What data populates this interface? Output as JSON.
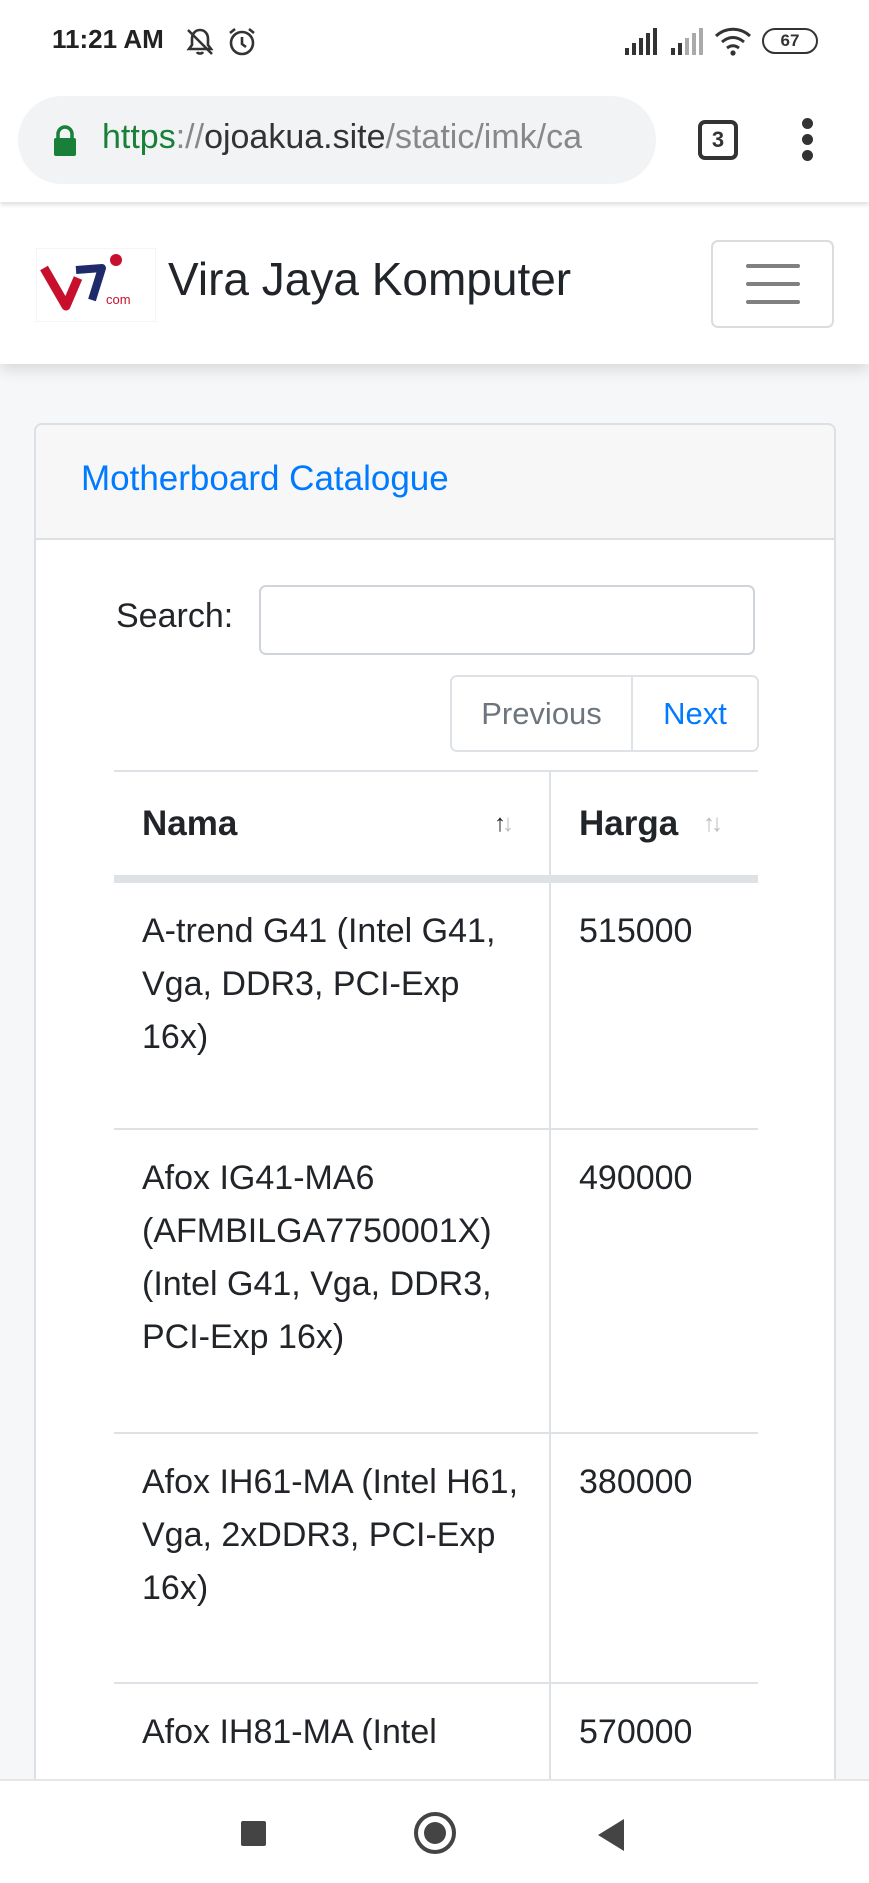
{
  "status_bar": {
    "time": "11:21 AM",
    "battery": "67",
    "icons": [
      "mute-icon",
      "alarm-icon",
      "signal-icon",
      "signal-weak-icon",
      "wifi-icon",
      "battery-icon"
    ]
  },
  "browser": {
    "url_scheme": "https",
    "url_sep": "://",
    "url_host": "ojoakua.site",
    "url_path": "/static/imk/ca",
    "tab_count": "3"
  },
  "navbar": {
    "brand_name": "Vira Jaya Komputer",
    "logo_text": "com"
  },
  "card": {
    "title": "Motherboard Catalogue",
    "search_label": "Search:",
    "search_value": "",
    "pagination": {
      "previous": "Previous",
      "next": "Next"
    }
  },
  "table": {
    "columns": [
      {
        "label": "Nama",
        "sort": "asc"
      },
      {
        "label": "Harga",
        "sort": "none"
      }
    ],
    "rows": [
      {
        "nama": "A-trend G41 (Intel G41, Vga, DDR3, PCI-Exp 16x)",
        "harga": "515000"
      },
      {
        "nama": "Afox IG41-MA6 (AFMBILGA7750001X) (Intel G41, Vga, DDR3, PCI-Exp 16x)",
        "harga": "490000"
      },
      {
        "nama": "Afox IH61-MA (Intel H61, Vga, 2xDDR3, PCI-Exp 16x)",
        "harga": "380000"
      },
      {
        "nama": "Afox IH81-MA (Intel",
        "harga": "570000"
      }
    ]
  },
  "colors": {
    "link_blue": "#007bff",
    "secure_green": "#188038",
    "logo_red": "#c8102e",
    "logo_navy": "#1f2a6b"
  }
}
